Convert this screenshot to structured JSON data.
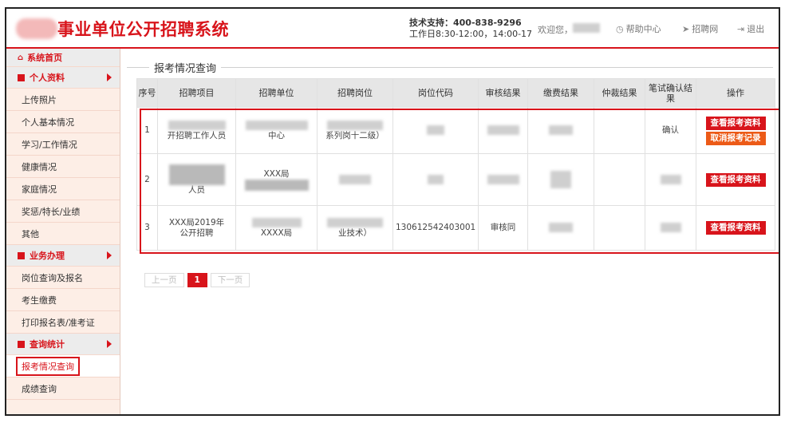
{
  "header": {
    "site_title": "事业单位公开招聘系统",
    "support_phone": "技术支持：400-838-9296",
    "support_hours": "工作日8:30-12:00，14:00-17",
    "welcome": "欢迎您，",
    "help_label": "帮助中心",
    "recruit_label": "招聘网",
    "logout_label": "退出"
  },
  "sidebar": {
    "home": "系统首页",
    "group_personal": "个人资料",
    "personal_items": [
      "上传照片",
      "个人基本情况",
      "学习/工作情况",
      "健康情况",
      "家庭情况",
      "奖惩/特长/业绩",
      "其他"
    ],
    "group_business": "业务办理",
    "business_items": [
      "岗位查询及报名",
      "考生缴费",
      "打印报名表/准考证"
    ],
    "group_query": "查询统计",
    "query_items": [
      "报考情况查询",
      "成绩查询"
    ]
  },
  "main": {
    "section_title": "报考情况查询",
    "columns": [
      "序号",
      "招聘项目",
      "招聘单位",
      "招聘岗位",
      "岗位代码",
      "审核结果",
      "缴费结果",
      "仲裁结果",
      "笔试确认结果",
      "操作"
    ],
    "rows": [
      {
        "no": "1",
        "project_tail": "开招聘工作人员",
        "unit_tail": "中心",
        "post_tail": "系列岗十二级）",
        "exam_confirm": "确认",
        "btn_view": "查看报考资料",
        "btn_cancel": "取消报考记录"
      },
      {
        "no": "2",
        "project_tail": "人员",
        "unit_head": "XXX局",
        "btn_view": "查看报考资料"
      },
      {
        "no": "3",
        "project_head": "XXX局2019年",
        "project_tail": "公开招聘",
        "unit_tail": "XXXX局",
        "post_tail": "业技术）",
        "post_code": "130612542403001",
        "review": "审核同",
        "btn_view": "查看报考资料"
      }
    ],
    "pager": {
      "prev": "上一页",
      "current": "1",
      "next": "下一页"
    }
  }
}
